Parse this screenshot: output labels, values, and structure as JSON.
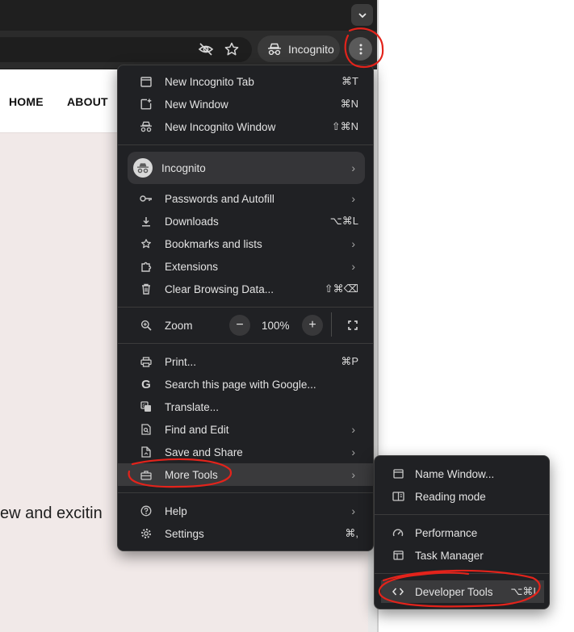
{
  "toolbar": {
    "incognito_label": "Incognito"
  },
  "site": {
    "nav": [
      "HOME",
      "ABOUT"
    ],
    "body_text": "ew and excitin"
  },
  "main_menu": {
    "group1": [
      {
        "label": "New Incognito Tab",
        "shortcut": "⌘T",
        "icon": "new-tab-icon"
      },
      {
        "label": "New Window",
        "shortcut": "⌘N",
        "icon": "new-window-icon"
      },
      {
        "label": "New Incognito Window",
        "shortcut": "⇧⌘N",
        "icon": "incognito-icon"
      }
    ],
    "profile": {
      "label": "Incognito",
      "icon": "incognito-avatar-icon"
    },
    "group2": [
      {
        "label": "Passwords and Autofill",
        "shortcut": "",
        "icon": "key-icon",
        "submenu": true
      },
      {
        "label": "Downloads",
        "shortcut": "⌥⌘L",
        "icon": "download-icon",
        "submenu": false
      },
      {
        "label": "Bookmarks and lists",
        "shortcut": "",
        "icon": "star-icon",
        "submenu": true
      },
      {
        "label": "Extensions",
        "shortcut": "",
        "icon": "puzzle-icon",
        "submenu": true
      },
      {
        "label": "Clear Browsing Data...",
        "shortcut": "⇧⌘⌫",
        "icon": "trash-icon",
        "submenu": false
      }
    ],
    "zoom": {
      "label": "Zoom",
      "value": "100%",
      "minus": "−",
      "plus": "+"
    },
    "group3": [
      {
        "label": "Print...",
        "shortcut": "⌘P",
        "icon": "print-icon",
        "submenu": false
      },
      {
        "label": "Search this page with Google...",
        "shortcut": "",
        "icon": "google-icon",
        "submenu": false
      },
      {
        "label": "Translate...",
        "shortcut": "",
        "icon": "translate-icon",
        "submenu": false
      },
      {
        "label": "Find and Edit",
        "shortcut": "",
        "icon": "find-icon",
        "submenu": true
      },
      {
        "label": "Save and Share",
        "shortcut": "",
        "icon": "save-icon",
        "submenu": true
      },
      {
        "label": "More Tools",
        "shortcut": "",
        "icon": "toolbox-icon",
        "submenu": true
      }
    ],
    "group4": [
      {
        "label": "Help",
        "shortcut": "",
        "icon": "help-icon",
        "submenu": true
      },
      {
        "label": "Settings",
        "shortcut": "⌘,",
        "icon": "settings-icon",
        "submenu": false
      }
    ]
  },
  "sub_menu": {
    "group1": [
      {
        "label": "Name Window...",
        "shortcut": "",
        "icon": "window-icon"
      },
      {
        "label": "Reading mode",
        "shortcut": "",
        "icon": "reading-icon"
      }
    ],
    "group2": [
      {
        "label": "Performance",
        "shortcut": "",
        "icon": "gauge-icon"
      },
      {
        "label": "Task Manager",
        "shortcut": "",
        "icon": "task-manager-icon"
      }
    ],
    "group3": [
      {
        "label": "Developer Tools",
        "shortcut": "⌥⌘I",
        "icon": "code-icon"
      }
    ]
  },
  "colors": {
    "menu_bg": "#202124",
    "highlight": "#3a3a3c",
    "annotation": "#e3231b",
    "page_bg": "#f1e9e8"
  }
}
